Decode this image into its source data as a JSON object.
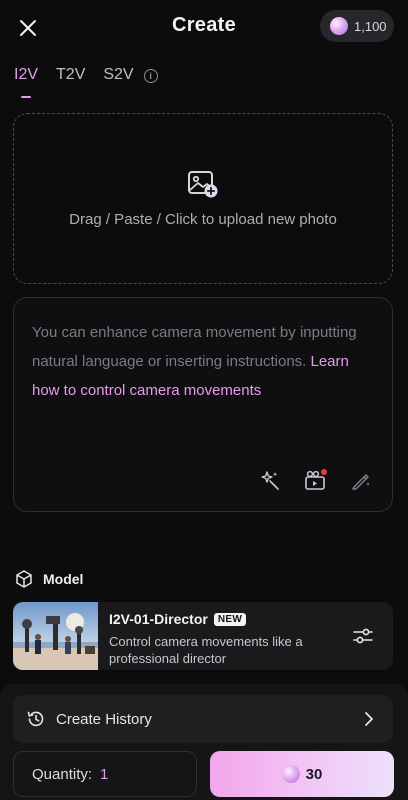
{
  "header": {
    "title": "Create",
    "credits": "1,100"
  },
  "tabs": [
    {
      "label": "I2V",
      "active": true
    },
    {
      "label": "T2V",
      "active": false
    },
    {
      "label": "S2V",
      "active": false
    }
  ],
  "upload": {
    "text": "Drag / Paste / Click to upload new photo"
  },
  "prompt": {
    "placeholder": "You can enhance camera movement by inputting natural language or inserting instructions. ",
    "link": "Learn how to control camera movements"
  },
  "model": {
    "section_label": "Model",
    "name": "I2V-01-Director",
    "badge": "NEW",
    "description": "Control camera movements like a professional director"
  },
  "history": {
    "label": "Create History"
  },
  "quantity": {
    "label": "Quantity:",
    "value": "1"
  },
  "generate": {
    "cost": "30"
  },
  "colors": {
    "accent": "#e59bec",
    "background": "#0c0c0d",
    "notification": "#f2383f"
  }
}
